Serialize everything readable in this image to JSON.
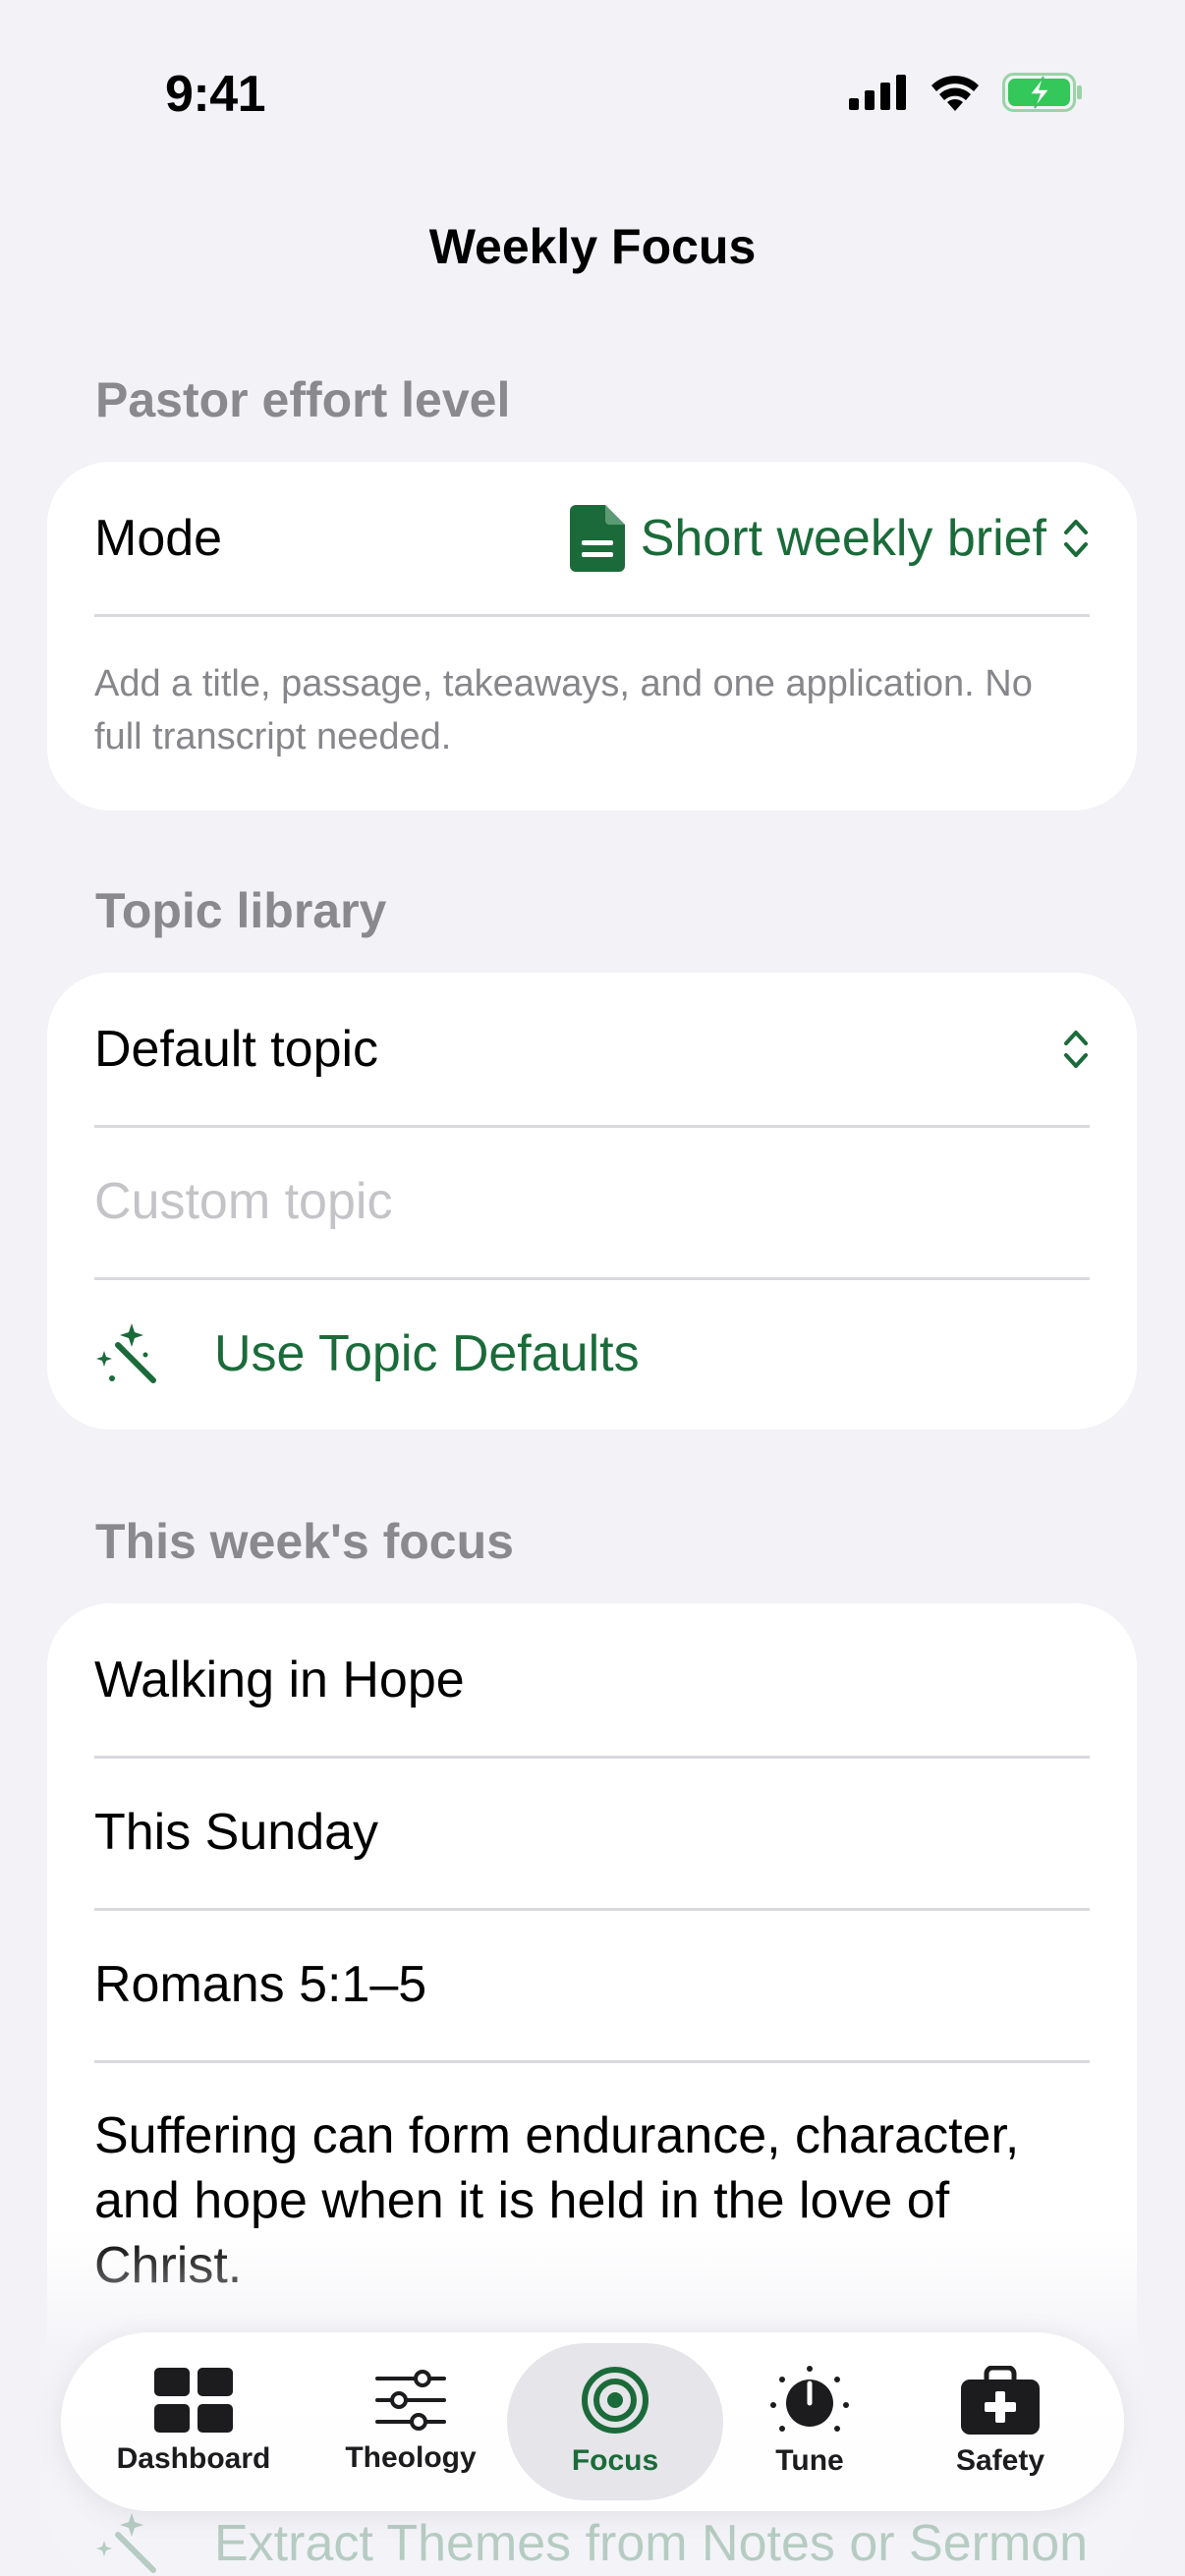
{
  "status_bar": {
    "time": "9:41"
  },
  "nav": {
    "title": "Weekly Focus"
  },
  "effort": {
    "header": "Pastor effort level",
    "mode_label": "Mode",
    "mode_value": "Short weekly brief",
    "description": "Add a title, passage, takeaways, and one application. No full transcript needed."
  },
  "topics": {
    "header": "Topic library",
    "default_topic_label": "Default topic",
    "custom_topic_placeholder": "Custom topic",
    "use_defaults_label": "Use Topic Defaults"
  },
  "focus": {
    "header": "This week's focus",
    "title_value": "Walking in Hope",
    "date_value": "This Sunday",
    "passage_value": "Romans 5:1–5",
    "takeaway_value": "Suffering can form endurance, character, and hope when it is held in the love of Christ.",
    "extract_label": "Extract Themes from Notes or Sermon"
  },
  "tab_bar": {
    "tabs": [
      {
        "label": "Dashboard",
        "icon": "grid-icon"
      },
      {
        "label": "Theology",
        "icon": "sliders-icon"
      },
      {
        "label": "Focus",
        "icon": "target-icon",
        "selected": true
      },
      {
        "label": "Tune",
        "icon": "timer-icon"
      },
      {
        "label": "Safety",
        "icon": "medkit-icon"
      }
    ]
  },
  "colors": {
    "accent": "#1b6b3a",
    "background": "#f2f2f7",
    "battery": "#34c759"
  }
}
